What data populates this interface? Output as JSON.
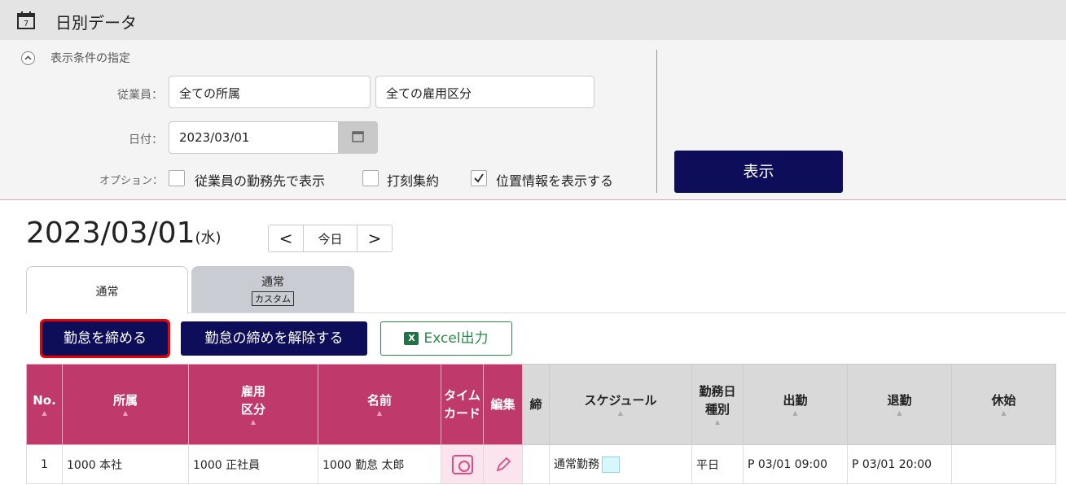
{
  "header": {
    "title": "日別データ",
    "icon": "calendar-icon"
  },
  "conditions": {
    "toggle_label": "表示条件の指定",
    "employee_label": "従業員：",
    "department_value": "全ての所属",
    "employment_value": "全ての雇用区分",
    "date_label": "日付：",
    "date_value": "2023/03/01",
    "options_label": "オプション：",
    "option1": "従業員の勤務先で表示",
    "option2": "打刻集約",
    "option3": "位置情報を表示する",
    "option1_checked": false,
    "option2_checked": false,
    "option3_checked": true,
    "show_button": "表示"
  },
  "date_display": {
    "date": "2023/03/01",
    "dow": "(水)",
    "prev": "<",
    "today": "今日",
    "next": ">"
  },
  "tabs": [
    {
      "label": "通常",
      "sub": ""
    },
    {
      "label": "通常",
      "sub": "カスタム"
    }
  ],
  "actions": {
    "close_label": "勤怠を締める",
    "unclose_label": "勤怠の締めを解除する",
    "excel_label": "Excel出力",
    "excel_icon": "X"
  },
  "table": {
    "headers": {
      "no": "No.",
      "dept": "所属",
      "emp_type": "雇用\n区分",
      "name": "名前",
      "timecard": "タイム\nカード",
      "edit": "編集",
      "closed": "締",
      "schedule": "スケジュール",
      "day_type": "勤務日\n種別",
      "clock_in": "出勤",
      "clock_out": "退勤",
      "break_start": "休始"
    },
    "rows": [
      {
        "no": "1",
        "dept": "1000 本社",
        "emp_type": "1000 正社員",
        "name": "1000 勤怠 太郎",
        "schedule": "通常勤務",
        "day_type": "平日",
        "clock_in": "P 03/01 09:00",
        "clock_out": "P 03/01 20:00",
        "break_start": ""
      }
    ]
  }
}
